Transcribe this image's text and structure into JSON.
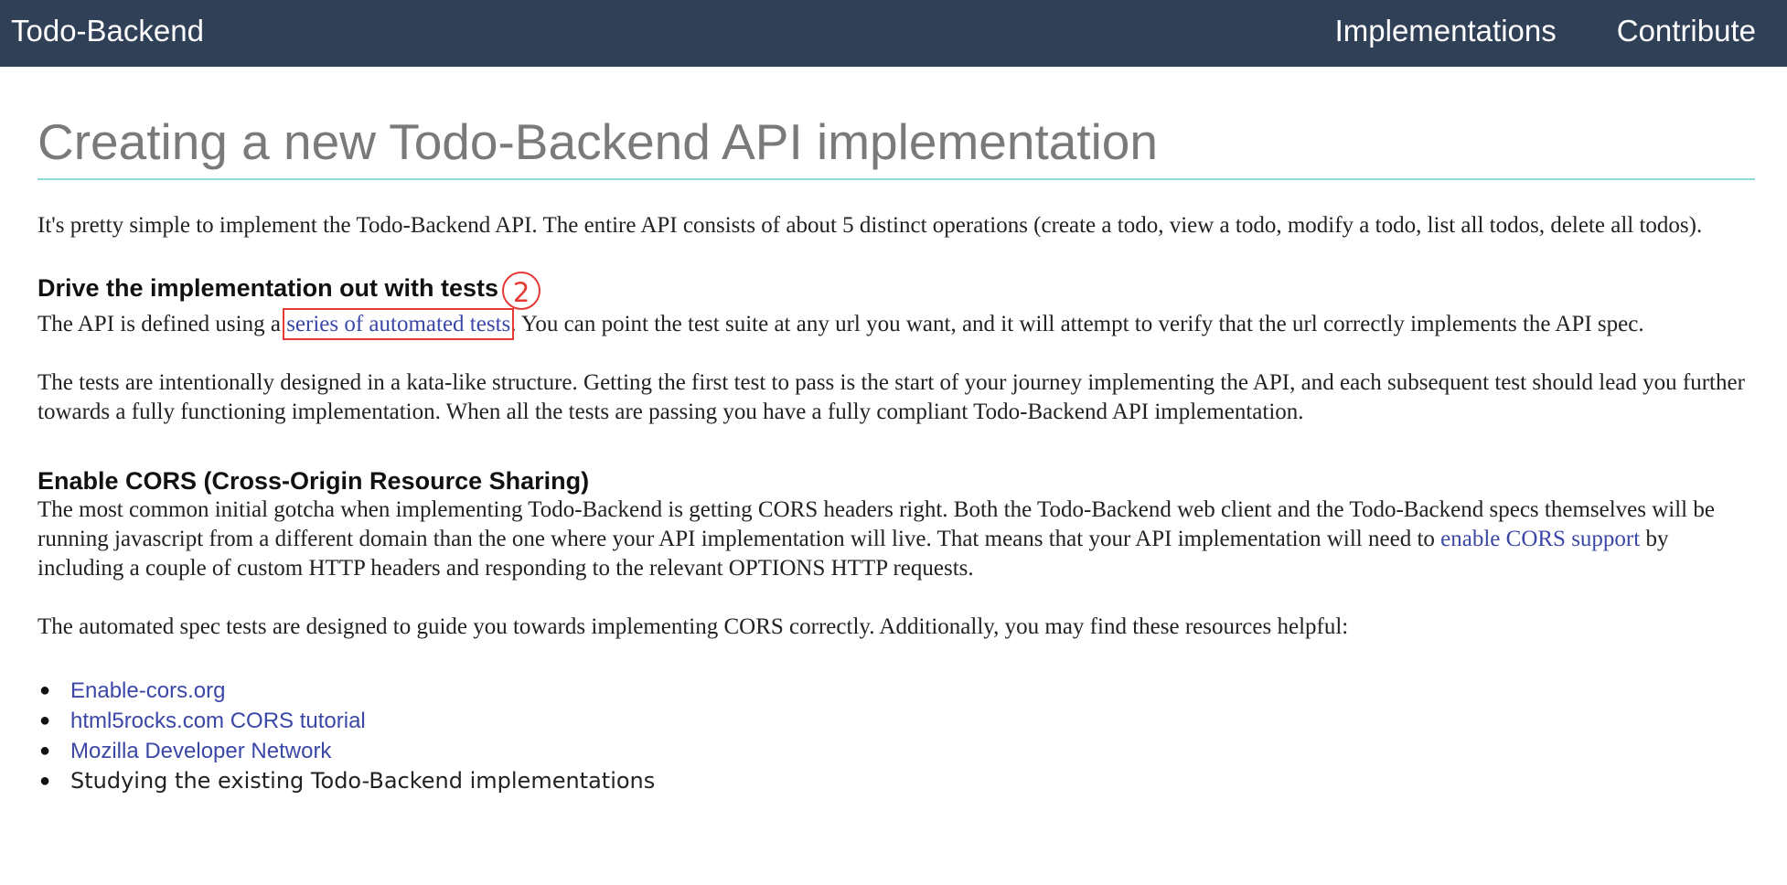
{
  "nav": {
    "brand": "Todo-Backend",
    "links": [
      "Implementations",
      "Contribute"
    ]
  },
  "title": "Creating a new Todo-Backend API implementation",
  "intro": "It's pretty simple to implement the Todo-Backend API. The entire API consists of about 5 distinct operations (create a todo, view a todo, modify a todo, list all todos, delete all todos).",
  "section_tests": {
    "heading": "Drive the implementation out with tests",
    "marker": "2",
    "p1_before": "The API is defined using a ",
    "p1_link": "series of automated tests",
    "p1_after": ". You can point the test suite at any url you want, and it will attempt to verify that the url correctly implements the API spec.",
    "p2": "The tests are intentionally designed in a kata-like structure. Getting the first test to pass is the start of your journey implementing the API, and each subsequent test should lead you further towards a fully functioning implementation. When all the tests are passing you have a fully compliant Todo-Backend API implementation."
  },
  "section_cors": {
    "heading": "Enable CORS (Cross-Origin Resource Sharing)",
    "p1_before": "The most common initial gotcha when implementing Todo-Backend is getting CORS headers right. Both the Todo-Backend web client and the Todo-Backend specs themselves will be running javascript from a different domain than the one where your API implementation will live. That means that your API implementation will need to ",
    "p1_link": "enable CORS support",
    "p1_after": " by including a couple of custom HTTP headers and responding to the relevant OPTIONS HTTP requests.",
    "p2": "The automated spec tests are designed to guide you towards implementing CORS correctly. Additionally, you may find these resources helpful:",
    "resources": [
      "Enable-cors.org",
      "html5rocks.com CORS tutorial",
      "Mozilla Developer Network"
    ],
    "resources_plain": "Studying the existing Todo-Backend implementations",
    "bullet": "●"
  },
  "colors": {
    "navbar_bg": "#2f4057",
    "link": "#3b47a6",
    "title": "#7a7a7a",
    "rule": "#8fd9d9",
    "highlight": "#e53935"
  }
}
